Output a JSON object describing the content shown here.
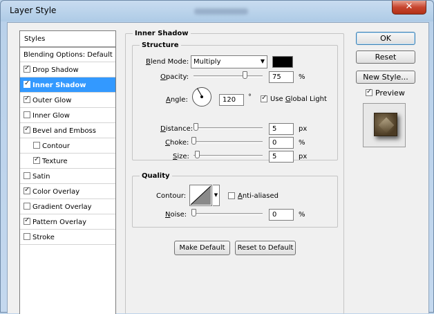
{
  "window": {
    "title": "Layer Style",
    "close_label": "✕"
  },
  "styles_panel": {
    "header": "Styles",
    "items": [
      {
        "label": "Blending Options: Default",
        "checkbox": false,
        "checked": false,
        "indent": false,
        "selected": false
      },
      {
        "label": "Drop Shadow",
        "checkbox": true,
        "checked": true,
        "indent": false,
        "selected": false
      },
      {
        "label": "Inner Shadow",
        "checkbox": true,
        "checked": true,
        "indent": false,
        "selected": true
      },
      {
        "label": "Outer Glow",
        "checkbox": true,
        "checked": true,
        "indent": false,
        "selected": false
      },
      {
        "label": "Inner Glow",
        "checkbox": true,
        "checked": false,
        "indent": false,
        "selected": false
      },
      {
        "label": "Bevel and Emboss",
        "checkbox": true,
        "checked": true,
        "indent": false,
        "selected": false
      },
      {
        "label": "Contour",
        "checkbox": true,
        "checked": false,
        "indent": true,
        "selected": false
      },
      {
        "label": "Texture",
        "checkbox": true,
        "checked": true,
        "indent": true,
        "selected": false
      },
      {
        "label": "Satin",
        "checkbox": true,
        "checked": false,
        "indent": false,
        "selected": false
      },
      {
        "label": "Color Overlay",
        "checkbox": true,
        "checked": true,
        "indent": false,
        "selected": false
      },
      {
        "label": "Gradient Overlay",
        "checkbox": true,
        "checked": false,
        "indent": false,
        "selected": false
      },
      {
        "label": "Pattern Overlay",
        "checkbox": true,
        "checked": true,
        "indent": false,
        "selected": false
      },
      {
        "label": "Stroke",
        "checkbox": true,
        "checked": false,
        "indent": false,
        "selected": false
      }
    ]
  },
  "inner_shadow": {
    "title": "Inner Shadow",
    "structure": {
      "title": "Structure",
      "blend_mode_label": "Blend Mode:",
      "blend_mode_value": "Multiply",
      "color": "#000000",
      "opacity_label": "Opacity:",
      "opacity_value": "75",
      "opacity_unit": "%",
      "opacity_level": 0.75,
      "angle_label": "Angle:",
      "angle_value": "120",
      "angle_unit": "°",
      "use_global_light_label": "Use Global Light",
      "use_global_light_checked": true,
      "distance_label": "Distance:",
      "distance_value": "5",
      "distance_unit": "px",
      "choke_label": "Choke:",
      "choke_value": "0",
      "choke_unit": "%",
      "size_label": "Size:",
      "size_value": "5",
      "size_unit": "px"
    },
    "quality": {
      "title": "Quality",
      "contour_label": "Contour:",
      "anti_aliased_label": "Anti-aliased",
      "anti_aliased_checked": false,
      "noise_label": "Noise:",
      "noise_value": "0",
      "noise_unit": "%"
    },
    "make_default_label": "Make Default",
    "reset_default_label": "Reset to Default"
  },
  "actions": {
    "ok_label": "OK",
    "reset_label": "Reset",
    "new_style_label": "New Style...",
    "preview_label": "Preview",
    "preview_checked": true
  },
  "colors": {
    "selection": "#3399ff",
    "window_frame": "#b9d1ea",
    "close_button": "#c7452f"
  }
}
